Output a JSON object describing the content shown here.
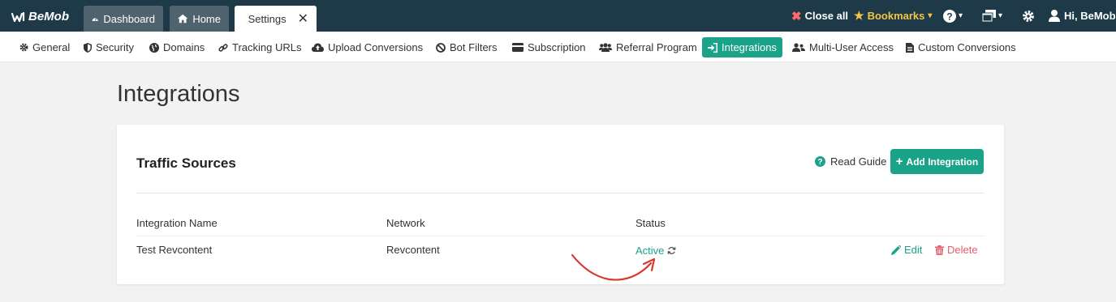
{
  "topbar": {
    "logo": "BeMob",
    "tabs": [
      {
        "label": "Dashboard",
        "icon": "dashboard-icon"
      },
      {
        "label": "Home",
        "icon": "home-icon"
      },
      {
        "label": "Settings",
        "icon": "gear-icon"
      }
    ],
    "close_all": "Close all",
    "bookmarks": "Bookmarks",
    "user": "Hi, BeMob"
  },
  "subnav": {
    "items": [
      {
        "label": "General",
        "icon": "gear-icon"
      },
      {
        "label": "Security",
        "icon": "shield-icon"
      },
      {
        "label": "Domains",
        "icon": "globe-icon"
      },
      {
        "label": "Tracking URLs",
        "icon": "link-icon"
      },
      {
        "label": "Upload Conversions",
        "icon": "cloud-upload-icon"
      },
      {
        "label": "Bot Filters",
        "icon": "ban-icon"
      },
      {
        "label": "Subscription",
        "icon": "credit-card-icon"
      },
      {
        "label": "Referral Program",
        "icon": "users-icon"
      },
      {
        "label": "Integrations",
        "icon": "sign-in-icon"
      },
      {
        "label": "Multi-User Access",
        "icon": "user-group-icon"
      },
      {
        "label": "Custom Conversions",
        "icon": "file-icon"
      }
    ]
  },
  "page": {
    "title": "Integrations",
    "card": {
      "title": "Traffic Sources",
      "read_guide": "Read Guide",
      "add_button": "Add Integration",
      "columns": [
        "Integration Name",
        "Network",
        "Status"
      ],
      "rows": [
        {
          "name": "Test Revcontent",
          "network": "Revcontent",
          "status": "Active",
          "edit": "Edit",
          "delete": "Delete"
        }
      ]
    }
  },
  "colors": {
    "topbar": "#1e3a48",
    "accent": "#1aa389",
    "danger": "#e35d6a",
    "bookmark": "#f5c542"
  }
}
